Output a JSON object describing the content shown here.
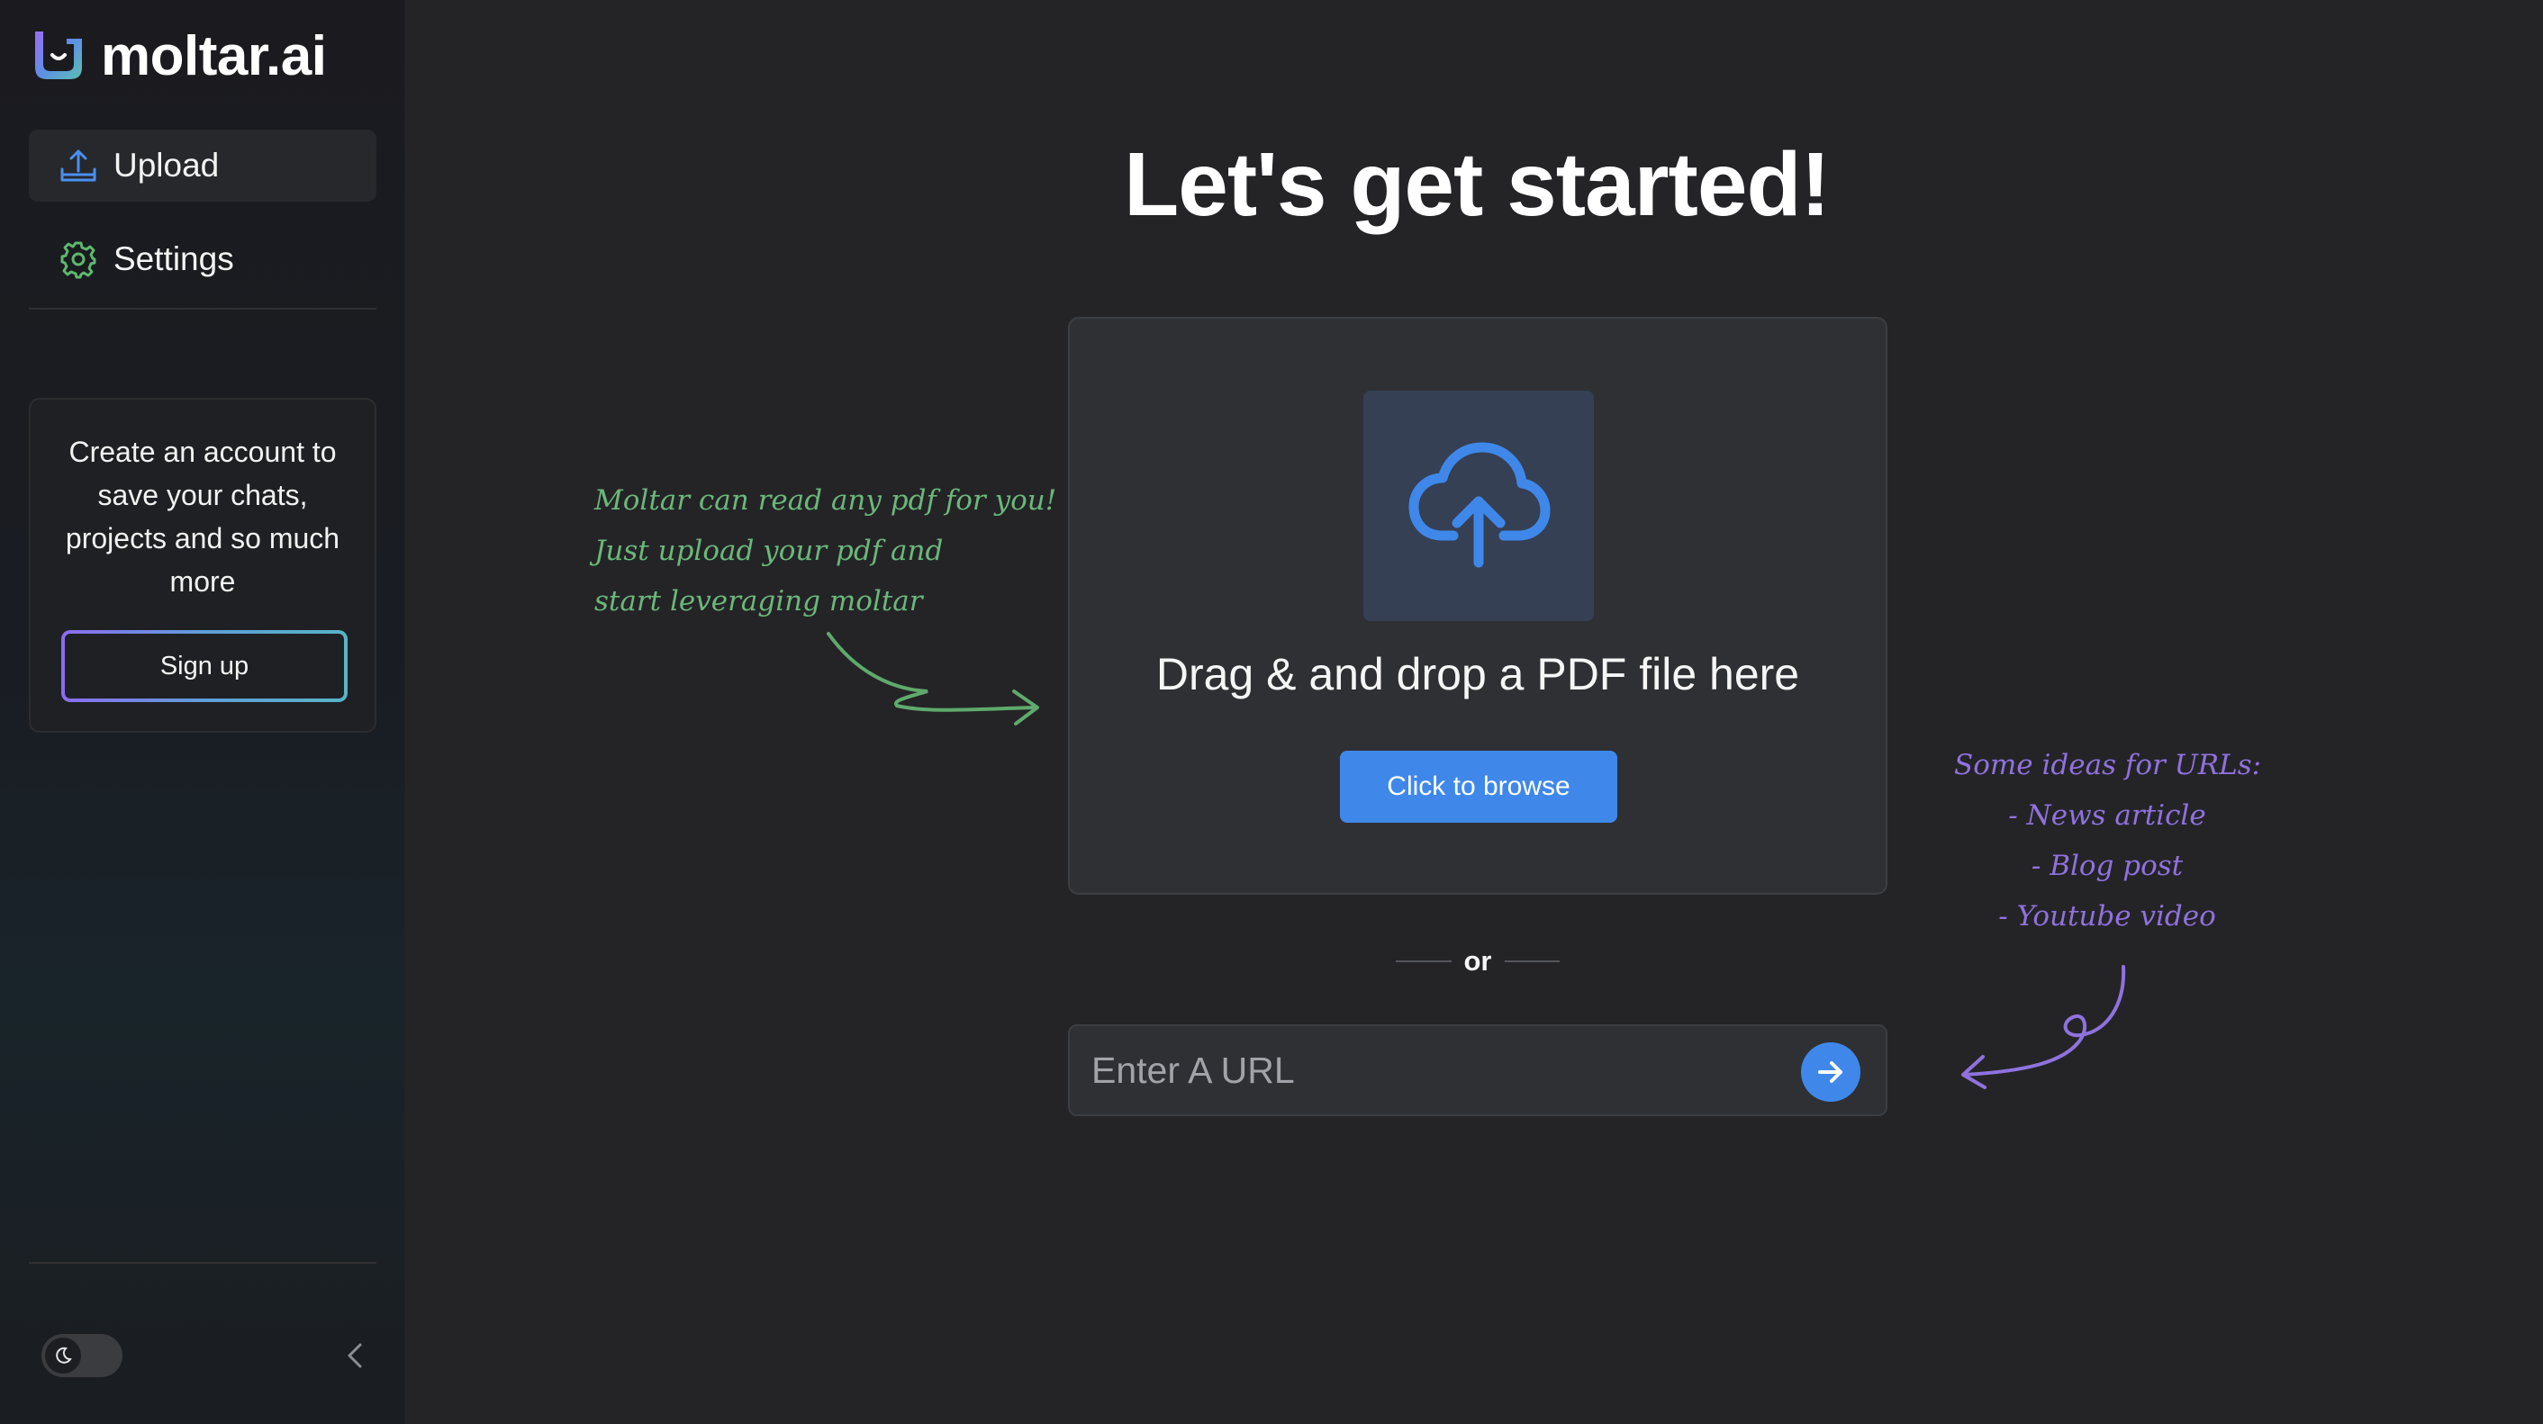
{
  "brand": {
    "name": "moltar.ai",
    "accent_purple": "#8b6cf0",
    "accent_blue": "#3f88ea",
    "accent_green": "#6bb87a"
  },
  "sidebar": {
    "items": [
      {
        "label": "Upload",
        "icon": "upload-icon",
        "active": true
      },
      {
        "label": "Settings",
        "icon": "gear-icon",
        "active": false
      }
    ],
    "promo": {
      "text": "Create an account to save your chats, projects and so much more",
      "button_label": "Sign up"
    },
    "theme_toggle": {
      "icon": "moon-icon",
      "state": "dark"
    },
    "collapse_icon": "chevron-left-icon"
  },
  "main": {
    "title": "Let's get started!",
    "dropzone": {
      "icon": "cloud-upload-icon",
      "text": "Drag & and drop a PDF file here",
      "button_label": "Click to browse"
    },
    "separator": "or",
    "url_input": {
      "placeholder": "Enter A URL",
      "value": "",
      "submit_icon": "arrow-right-icon"
    },
    "note_left": {
      "lines": [
        "Moltar can read any pdf for you!",
        "Just upload your pdf and",
        "start leveraging moltar"
      ]
    },
    "note_right": {
      "lines": [
        "Some ideas for URLs:",
        "- News article",
        "- Blog post",
        "- Youtube video"
      ]
    }
  }
}
